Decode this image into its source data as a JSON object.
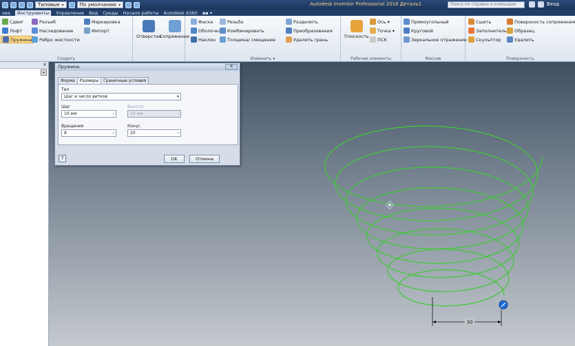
{
  "titlebar": {
    "material": "Типовые",
    "appearance": "По умолчанию",
    "app_title": "Autodesk Inventor Professional 2016   Деталь1",
    "search_placeholder": "Поиск по справке и командам",
    "user_label": "Вход"
  },
  "menu": {
    "tabs": [
      "ева",
      "Инструменты",
      "Управление",
      "Вид",
      "Среды",
      "Начало работы",
      "Autodesk A360",
      "▪▪ ▾"
    ],
    "active_index": 1
  },
  "ribbon": {
    "groups": [
      {
        "title": "Создать",
        "items": [
          "Сдвиг",
          "Лофт",
          "Пружина",
          "Разъеб",
          "Наследование",
          "Ребро жесткости",
          "Маркировка",
          "Импорт"
        ]
      },
      {
        "title": "",
        "items": [
          "Отверстие",
          "Сопряжение"
        ]
      },
      {
        "title": "Изменить ▾",
        "items": [
          "Фаска",
          "Оболочка",
          "Наклон",
          "Резьба",
          "Комбинировать",
          "Толщина/ смещение",
          "Разделить",
          "Преобразования",
          "Удалить грань"
        ]
      },
      {
        "title": "Рабочие элементы",
        "items": [
          "Плоскость",
          "Ось ▾",
          "Точка ▾",
          "ПСК"
        ]
      },
      {
        "title": "Массив",
        "items": [
          "Прямоугольный",
          "Круговой",
          "Зеркальное отражение"
        ]
      },
      {
        "title": "Поверхность",
        "items": [
          "Сшить",
          "Заполнитель",
          "Скульптор",
          "Поверхность сопряжения",
          "Образец",
          "Удалить"
        ]
      }
    ]
  },
  "dialog": {
    "title": "Пружина",
    "close_label": "✕",
    "tabs": [
      "Форма",
      "Размеры",
      "Граничные условия"
    ],
    "active_tab": 1,
    "type_label": "Тип",
    "type_value": "Шаг и число витков",
    "pitch_label": "Шаг",
    "pitch_value": "10 мм",
    "height_label": "Высота",
    "height_value": "10 мм",
    "revolutions_label": "Вращения",
    "revolutions_value": "8",
    "taper_label": "Конус",
    "taper_value": "20",
    "help_label": "?",
    "ok_label": "OK",
    "cancel_label": "Отмена"
  },
  "viewport": {
    "dimension_label": "30",
    "helix_color": "#43c83a",
    "helix_turns": 8,
    "taper_deg": 20
  }
}
